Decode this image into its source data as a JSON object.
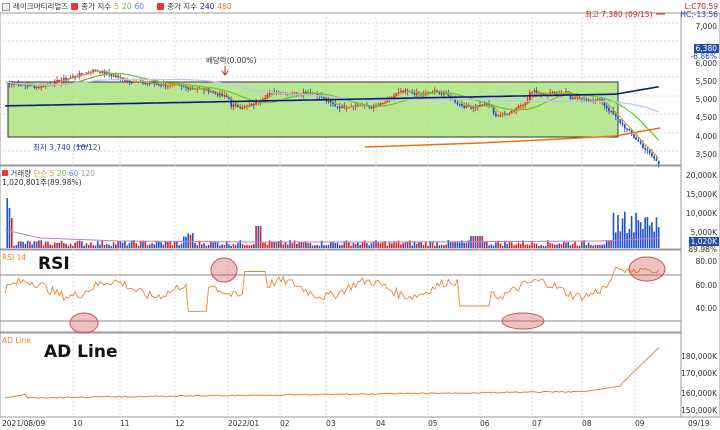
{
  "header": {
    "stock_name": "레이크머티리얼즈",
    "ma_label": "종가 지수",
    "ma_values": [
      "5",
      "20",
      "60"
    ],
    "ma2_label": "종가 지수",
    "ma2_values": [
      "240",
      "480"
    ]
  },
  "price_panel": {
    "axis_ticks": [
      "7,000",
      "6,500",
      "6,000",
      "5,500",
      "5,000",
      "4,500",
      "4,000",
      "3,500"
    ],
    "current_price": "6,380",
    "pct_label": "-6.86%",
    "top_right_lines": [
      "L:C70.59",
      "HC:-13.56"
    ],
    "high_annotation": "최고 7,380 (09/15)",
    "low_annotation": "최저 3,740 (10/12)",
    "dividend_annotation": "배당락(0.00%)"
  },
  "volume_panel": {
    "header_label": "거래량",
    "header_ma_label": "단순",
    "header_ma_values": [
      "5",
      "20",
      "60",
      "120"
    ],
    "sub_label": "1,020,801주(89.98%)",
    "axis_ticks": [
      "20,000K",
      "15,000K",
      "10,000K",
      "5,000K"
    ],
    "current_volume": "1,020K",
    "tag2": "89.98%"
  },
  "rsi_panel": {
    "header_label": "RSI 14",
    "overlay_label": "RSI",
    "axis_ticks": [
      "80.00",
      "60.00",
      "40.00"
    ]
  },
  "ad_panel": {
    "header_label": "AD Line",
    "overlay_label": "AD Line",
    "axis_ticks": [
      "180,000K",
      "170,000K",
      "160,000K",
      "150,000K"
    ]
  },
  "x_axis": {
    "labels": [
      "2021/08/09",
      "10",
      "11",
      "12",
      "2022/01",
      "02",
      "03",
      "04",
      "05",
      "06",
      "07",
      "08",
      "09",
      "09/19"
    ]
  },
  "colors": {
    "up_candle": "#e02020",
    "down_candle": "#2050d0",
    "ma5": "#d4a020",
    "ma20": "#70c030",
    "ma60": "#6080ff",
    "ma240": "#0a1a8a",
    "ma480": "#f07010",
    "highlight_box": "#a0e070",
    "rsi_line": "#f08030",
    "ad_line": "#f08030",
    "circle": "#d05050"
  }
}
